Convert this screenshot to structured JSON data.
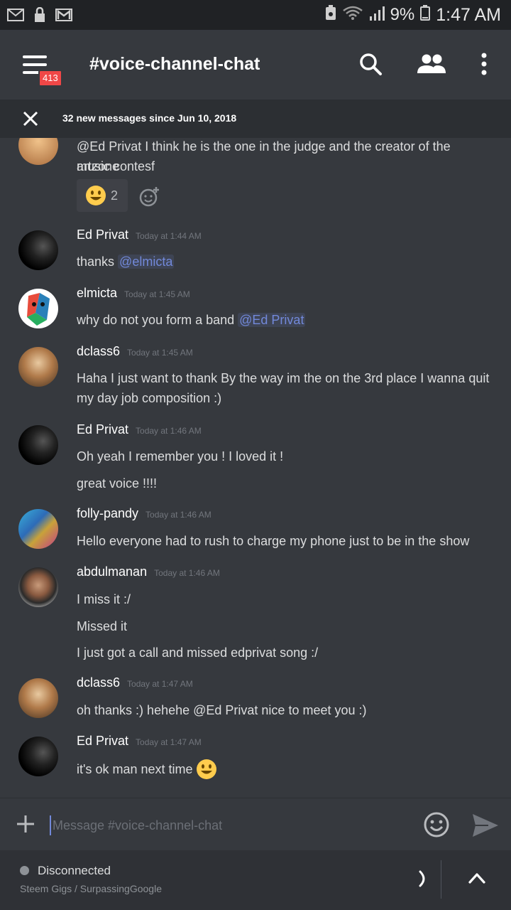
{
  "statusbar": {
    "battery_pct": "9%",
    "time": "1:47 AM"
  },
  "appbar": {
    "channel_title": "#voice-channel-chat",
    "unread_badge": "413"
  },
  "banner": {
    "text": "32 new messages since Jun 10, 2018"
  },
  "messages": {
    "partial": {
      "line1": "@Ed Privat I think he is the one in the judge and the creator of the artzone",
      "line2": "music contesf",
      "reaction_count": "2"
    },
    "m1": {
      "author": "Ed Privat",
      "ts": "Today at 1:44 AM",
      "pre": "thanks ",
      "mention": "@elmicta"
    },
    "m2": {
      "author": "elmicta",
      "ts": "Today at 1:45 AM",
      "pre": "why do not you form a band ",
      "mention": "@Ed Privat"
    },
    "m3": {
      "author": "dclass6",
      "ts": "Today at 1:45 AM",
      "line1": "Haha I just want to thank By the way im the on the 3rd place I wanna quit",
      "line2": "my day job composition :)"
    },
    "m4": {
      "author": "Ed Privat",
      "ts": "Today at 1:46 AM",
      "line1": "Oh yeah I remember you ! I loved it !",
      "line2": "great voice !!!!"
    },
    "m5": {
      "author": "folly-pandy",
      "ts": "Today at 1:46 AM",
      "line1": "Hello everyone had to rush to charge my phone just to be in the show"
    },
    "m6": {
      "author": "abdulmanan",
      "ts": "Today at 1:46 AM",
      "line1": "I miss it :/",
      "line2": "Missed it",
      "line3": "I just got a call and missed edprivat song :/"
    },
    "m7": {
      "author": "dclass6",
      "ts": "Today at 1:47 AM",
      "line1": "oh thanks :) hehehe @Ed Privat nice to meet you :)"
    },
    "m8": {
      "author": "Ed Privat",
      "ts": "Today at 1:47 AM",
      "line1": "it's ok man next time"
    }
  },
  "composer": {
    "placeholder": "Message #voice-channel-chat"
  },
  "voice": {
    "status": "Disconnected",
    "sub": "Steem Gigs / SurpassingGoogle"
  },
  "icons": {
    "status_left": [
      "mail-icon",
      "lock-icon",
      "gmail-icon"
    ],
    "status_right": [
      "recycle-icon",
      "wifi-icon",
      "signal-icon",
      "battery-icon"
    ],
    "appbar": [
      "menu-icon",
      "search-icon",
      "members-icon",
      "more-vert-icon"
    ],
    "composer": [
      "plus-icon",
      "emoji-icon",
      "send-icon"
    ],
    "voice": [
      "status-dot-icon",
      "moon-icon",
      "chevron-up-icon"
    ]
  },
  "colors": {
    "background": "#36393e",
    "statusbar": "#202225",
    "mention": "#7289da",
    "badge": "#f04747",
    "voicebar": "#2f3136"
  }
}
